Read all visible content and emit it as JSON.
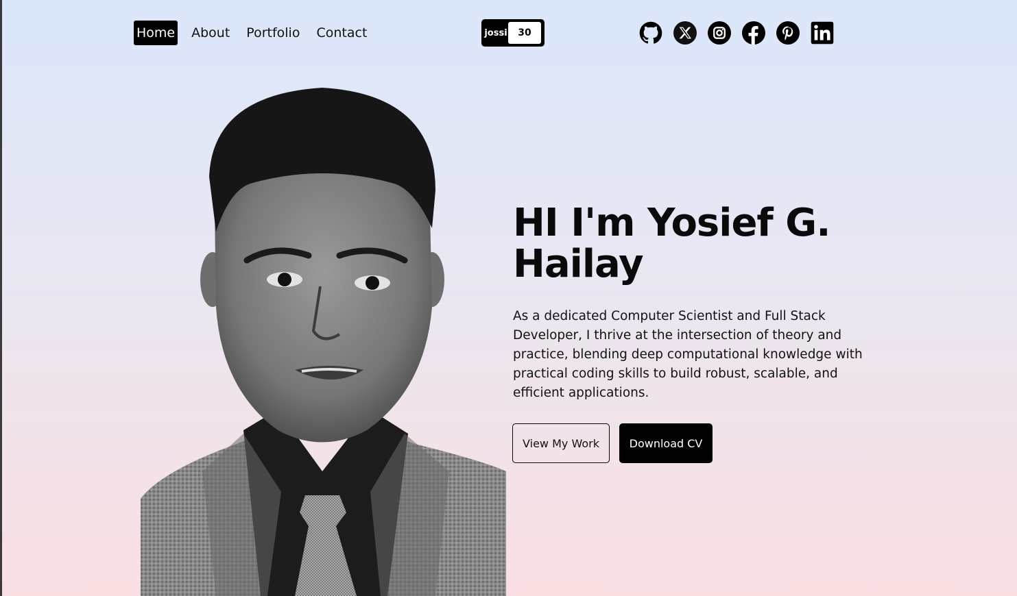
{
  "nav": {
    "items": [
      {
        "label": "Home",
        "active": true
      },
      {
        "label": "About",
        "active": false
      },
      {
        "label": "Portfolio",
        "active": false
      },
      {
        "label": "Contact",
        "active": false
      }
    ]
  },
  "counter": {
    "label": "jossi",
    "value": "30"
  },
  "socials": [
    {
      "icon": "github-icon"
    },
    {
      "icon": "x-twitter-icon"
    },
    {
      "icon": "instagram-icon"
    },
    {
      "icon": "facebook-icon"
    },
    {
      "icon": "pinterest-icon"
    },
    {
      "icon": "linkedin-icon"
    }
  ],
  "hero": {
    "title": "HI I'm Yosief G. Hailay",
    "description": "As a dedicated Computer Scientist and Full Stack Developer, I thrive at the intersection of theory and practice, blending deep computational knowledge with practical coding skills to build robust, scalable, and efficient applications.",
    "primary_button": "View My Work",
    "secondary_button": "Download CV"
  },
  "colors": {
    "accent": "#000000",
    "background_top": "#dbe7fb",
    "background_bottom": "#fadfe2"
  }
}
